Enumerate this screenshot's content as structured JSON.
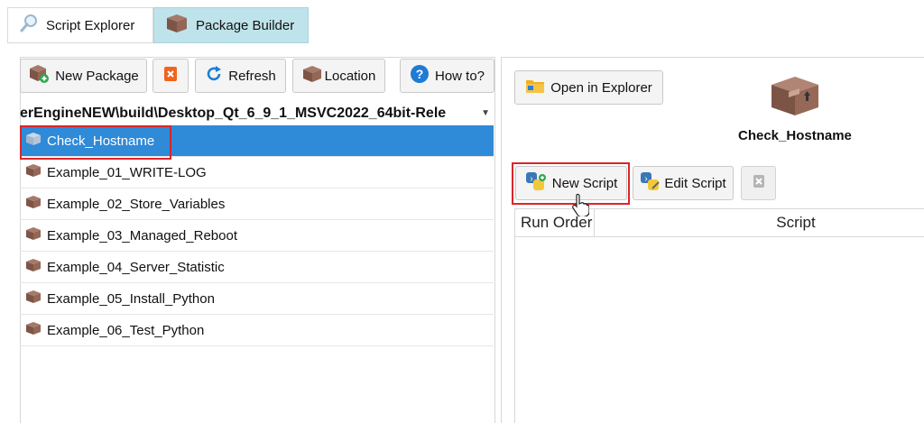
{
  "tabs": [
    {
      "label": "Script Explorer",
      "icon": "magnifier-icon",
      "active": false
    },
    {
      "label": "Package Builder",
      "icon": "package-box-icon",
      "active": true
    }
  ],
  "toolbar": {
    "new_package": "New Package",
    "delete_icon": "delete-icon",
    "refresh": "Refresh",
    "location": "Location",
    "how_to": "How to?"
  },
  "path": "erEngineNEW\\build\\Desktop_Qt_6_9_1_MSVC2022_64bit-Rele",
  "packages": [
    {
      "label": "Check_Hostname",
      "selected": true
    },
    {
      "label": "Example_01_WRITE-LOG",
      "selected": false
    },
    {
      "label": "Example_02_Store_Variables",
      "selected": false
    },
    {
      "label": "Example_03_Managed_Reboot",
      "selected": false
    },
    {
      "label": "Example_04_Server_Statistic",
      "selected": false
    },
    {
      "label": "Example_05_Install_Python",
      "selected": false
    },
    {
      "label": "Example_06_Test_Python",
      "selected": false
    }
  ],
  "right": {
    "open_explorer": "Open in Explorer",
    "package_name": "Check_Hostname",
    "new_script": "New Script",
    "edit_script": "Edit Script",
    "columns": {
      "run_order": "Run Order",
      "script": "Script"
    }
  },
  "colors": {
    "selection": "#2f8ad8",
    "highlight_box": "#d9262b",
    "active_tab": "#bfe3ea"
  }
}
